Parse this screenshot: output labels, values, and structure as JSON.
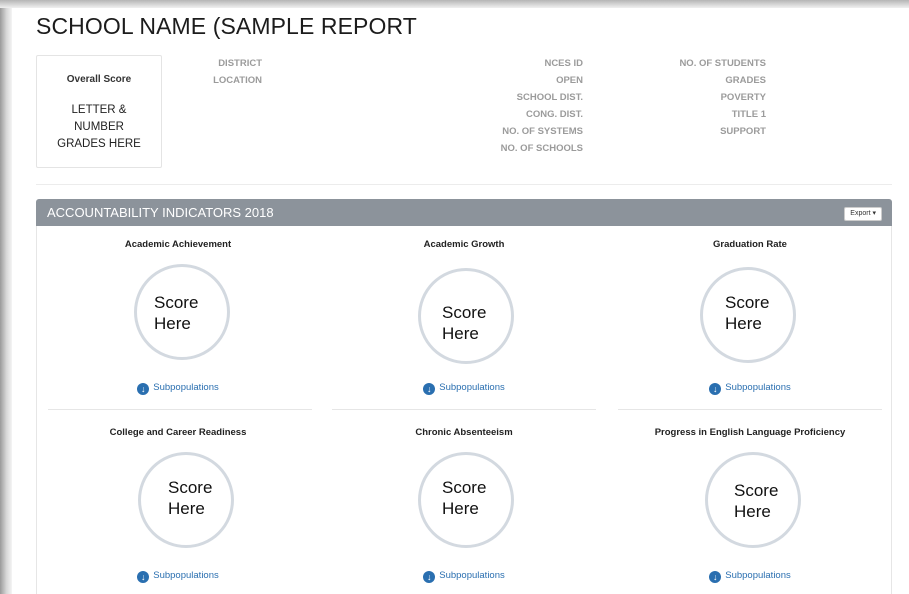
{
  "title": "SCHOOL NAME (SAMPLE REPORT",
  "overall": {
    "label": "Overall Score",
    "grades": "LETTER &\nNUMBER\nGRADES HERE"
  },
  "meta": {
    "col1": [
      "DISTRICT",
      "LOCATION"
    ],
    "col2": [
      "NCES ID",
      "OPEN",
      "SCHOOL DIST.",
      "CONG. DIST.",
      "NO. OF SYSTEMS",
      "NO. OF SCHOOLS"
    ],
    "col3": [
      "NO. OF STUDENTS",
      "GRADES",
      "POVERTY",
      "TITLE 1",
      "SUPPORT"
    ]
  },
  "panel": {
    "title": "ACCOUNTABILITY INDICATORS 2018",
    "export_label": "Export ▾",
    "indicators": [
      {
        "title": "Academic Achievement",
        "score": "Score\nHere",
        "link": "Subpopulations"
      },
      {
        "title": "Academic Growth",
        "score": "Score\nHere",
        "link": "Subpopulations"
      },
      {
        "title": "Graduation Rate",
        "score": "Score\nHere",
        "link": "Subpopulations"
      },
      {
        "title": "College and Career Readiness",
        "score": "Score\nHere",
        "link": "Subpopulations"
      },
      {
        "title": "Chronic Absenteeism",
        "score": "Score\nHere",
        "link": "Subpopulations"
      },
      {
        "title": "Progress in English Language Proficiency",
        "score": "Score\nHere",
        "link": "Subpopulations"
      }
    ]
  },
  "icons": {
    "download": "download-circle-icon"
  },
  "colors": {
    "header_bg": "#8c939b",
    "link": "#2a6fb0",
    "circle_border": "#d3d9e0"
  }
}
